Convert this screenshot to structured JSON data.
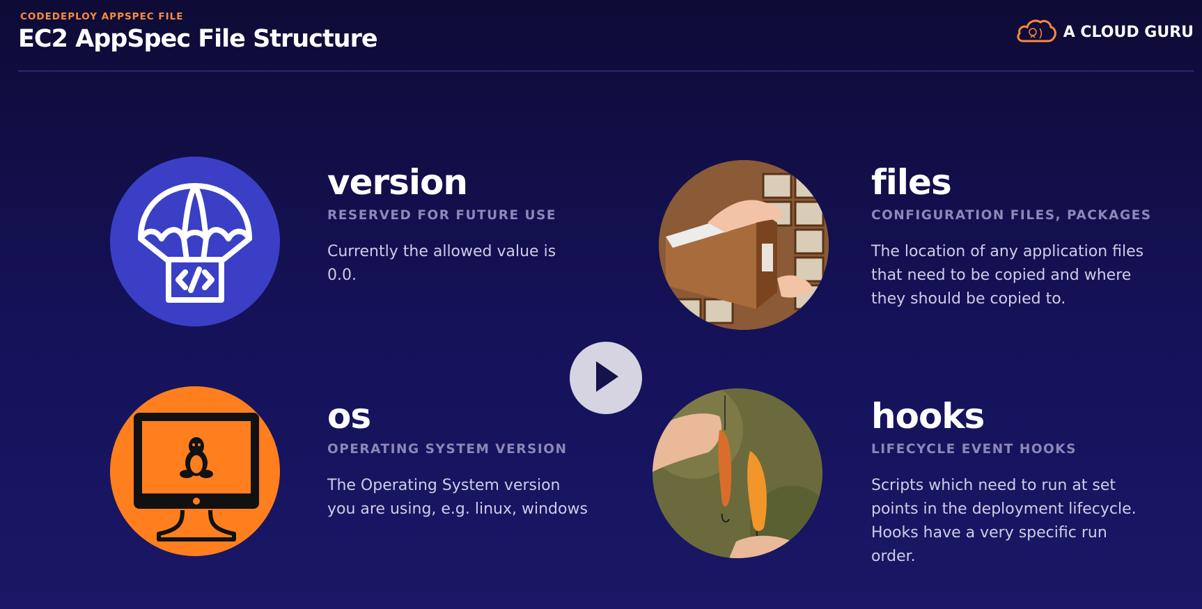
{
  "header": {
    "eyebrow": "CODEDEPLOY APPSPEC FILE",
    "title": "EC2 AppSpec File Structure",
    "brand": "A CLOUD GURU"
  },
  "colors": {
    "background": "#15125a",
    "accent_orange": "#ff8a3d",
    "version_circle": "#3a3fc6",
    "os_circle": "#ff7f1f",
    "subtitle": "#8c88b8"
  },
  "items": [
    {
      "key": "version",
      "title": "version",
      "subtitle": "RESERVED FOR FUTURE USE",
      "description": "Currently the allowed value is 0.0.",
      "icon": "parachute-code-icon"
    },
    {
      "key": "files",
      "title": "files",
      "subtitle": "CONFIGURATION FILES, PACKAGES",
      "description": "The location of any application files that need to be copied and where they should be copied to.",
      "icon": "file-cabinet-photo"
    },
    {
      "key": "os",
      "title": "os",
      "subtitle": "OPERATING SYSTEM VERSION",
      "description": "The Operating System version you are using, e.g. linux, windows",
      "icon": "linux-monitor-icon"
    },
    {
      "key": "hooks",
      "title": "hooks",
      "subtitle": "LIFECYCLE EVENT HOOKS",
      "description": "Scripts which need to run at set points in the deployment lifecycle. Hooks have a very specific run order.",
      "icon": "fishing-lures-photo"
    }
  ],
  "player": {
    "play_icon": "play-icon"
  }
}
